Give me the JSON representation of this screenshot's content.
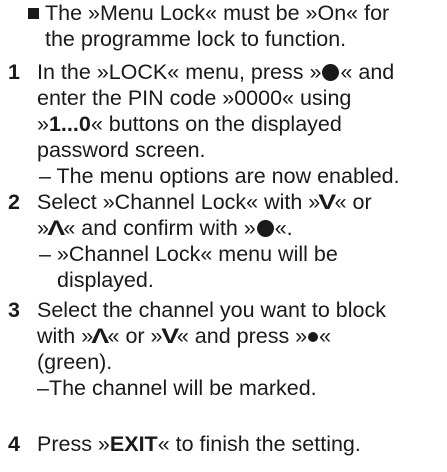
{
  "note": {
    "text_line1": "The »Menu Lock« must be »On« for",
    "text_line2": "the programme lock to function."
  },
  "steps": [
    {
      "number": "1",
      "lines": [
        "In the »LOCK« menu, press »",
        "« and",
        "enter the PIN code »0000« using",
        "»",
        "1...0",
        "« buttons on the displayed",
        "password screen."
      ],
      "sub": "– The menu options are now enabled."
    },
    {
      "number": "2",
      "line1_a": "Select »Channel Lock« with »",
      "line1_b": "« or",
      "line2_a": "»",
      "line2_b": "« and confirm with »",
      "line2_c": "«.",
      "sub_line1": "– »Channel Lock« menu will be",
      "sub_line2": "displayed."
    },
    {
      "number": "3",
      "line1": "Select the channel you want to block",
      "line2_a": "with »",
      "line2_b": "« or »",
      "line2_c": "« and press »",
      "line2_d": "«",
      "line3": "(green).",
      "sub": "–The channel will be marked."
    },
    {
      "number": "4",
      "line1_a": "Press »",
      "line1_exit": "EXIT",
      "line1_b": "« to finish the setting."
    }
  ],
  "icons": {
    "ok_button": "filled-circle-icon",
    "down_button": "chevron-down-icon",
    "up_button": "chevron-up-icon",
    "green_button": "small-filled-circle-icon"
  }
}
